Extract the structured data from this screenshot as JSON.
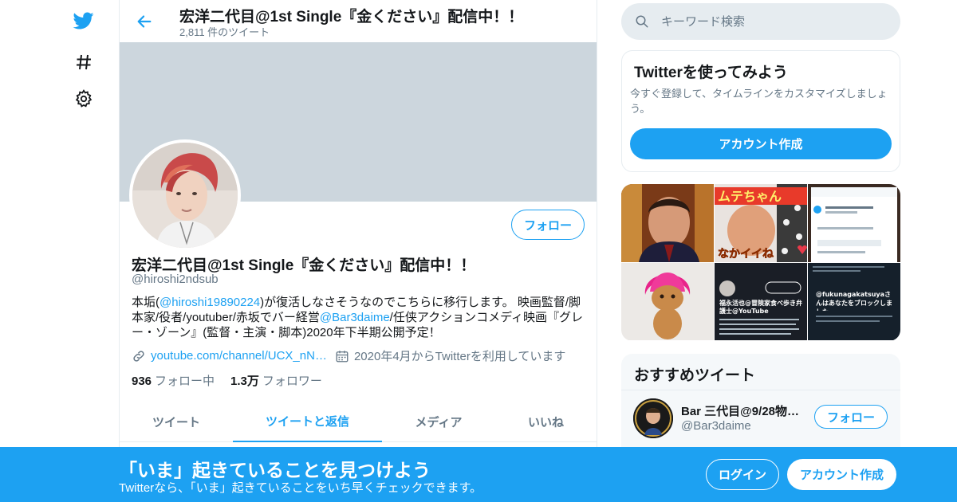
{
  "colors": {
    "accent": "#1da1f2",
    "text": "#14171a",
    "muted": "#657786",
    "banner": "#ccd6dd",
    "border": "#e6ecf0"
  },
  "rail": {
    "icons": [
      "twitter-logo-icon",
      "hashtag-icon",
      "gear-icon"
    ]
  },
  "header": {
    "title": "宏洋二代目@1st Single『金ください』配信中！！",
    "tweet_count": "2,811 件のツイート"
  },
  "profile": {
    "follow_label": "フォロー",
    "name": "宏洋二代目@1st Single『金ください』配信中！！",
    "handle": "@hiroshi2ndsub",
    "bio": {
      "part1": "本垢(",
      "mention1": "@hiroshi19890224",
      "part2": ")が復活しなさそうなのでこちらに移行します。 映画監督/脚本家/役者/youtuber/赤坂でバー経営",
      "mention2": "@Bar3daime",
      "part3": "/任侠アクションコメディ映画『グレー・ゾーン』(監督・主演・脚本)2020年下半期公開予定！"
    },
    "website": "youtube.com/channel/UCX_nN…",
    "joined": "2020年4月からTwitterを利用しています",
    "following_count": "936",
    "following_label": "フォロー中",
    "followers_count": "1.3万",
    "followers_label": "フォロワー"
  },
  "tabs": [
    {
      "label": "ツイート",
      "active": false
    },
    {
      "label": "ツイートと返信",
      "active": true
    },
    {
      "label": "メディア",
      "active": false
    },
    {
      "label": "いいね",
      "active": false
    }
  ],
  "search": {
    "placeholder": "キーワード検索"
  },
  "signup_card": {
    "title": "Twitterを使ってみよう",
    "desc": "今すぐ登録して、タイムラインをカスタマイズしましょう。",
    "button": "アカウント作成"
  },
  "media_grid": {
    "cells": [
      {
        "name": "media-thumb-older-man",
        "caption": ""
      },
      {
        "name": "media-thumb-mute-chan",
        "caption": "ムテちゃん",
        "caption2": "なかイイね"
      },
      {
        "name": "media-thumb-screenshot-dialog",
        "caption": ""
      },
      {
        "name": "media-thumb-troll-doll",
        "caption": ""
      },
      {
        "name": "media-thumb-youtube-lawyer",
        "caption": "福永活也@冒険家食べ歩き弁護士@YouTube"
      },
      {
        "name": "media-thumb-blocked-notice",
        "caption": "@fukunagakatsuyaさんはあなたをブロックしました"
      }
    ]
  },
  "reco": {
    "title": "おすすめツイート",
    "user_name": "Bar 三代目@9/28物…",
    "user_handle": "@Bar3daime",
    "follow_label": "フォロー"
  },
  "bottom_bar": {
    "title": "「いま」起きていることを見つけよう",
    "subtitle": "Twitterなら、「いま」起きていることをいち早くチェックできます。",
    "login": "ログイン",
    "signup": "アカウント作成"
  }
}
